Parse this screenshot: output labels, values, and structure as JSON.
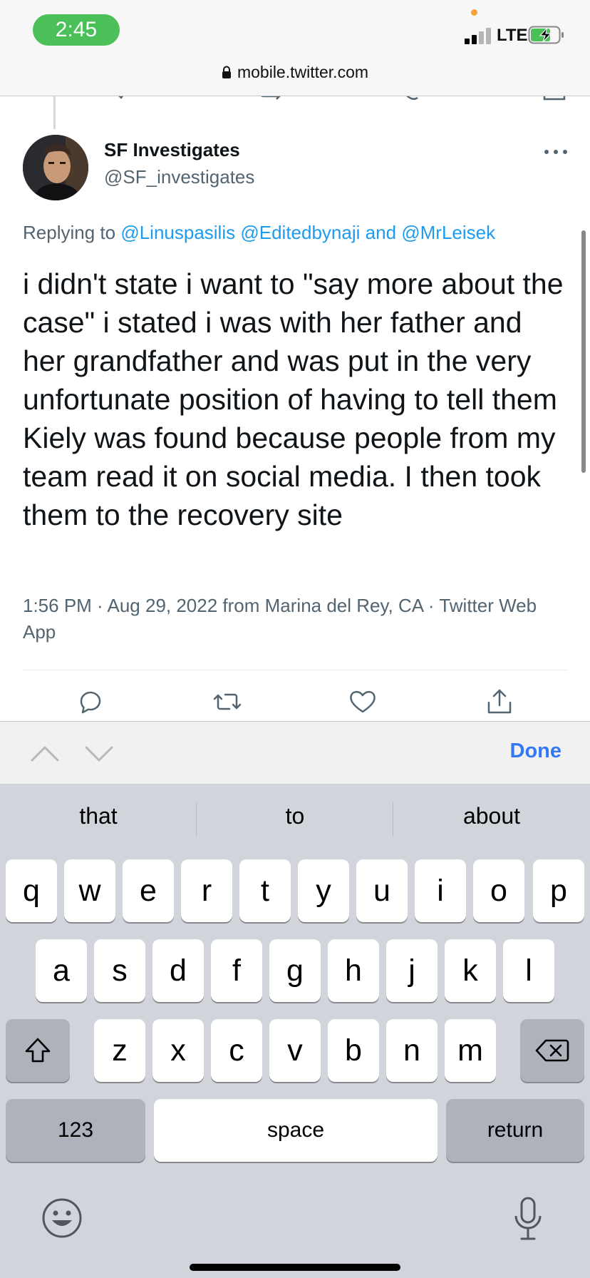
{
  "status_bar": {
    "time": "2:45",
    "network": "LTE"
  },
  "browser": {
    "url": "mobile.twitter.com"
  },
  "tweet": {
    "display_name": "SF Investigates",
    "handle": "@SF_investigates",
    "replying_prefix": "Replying to ",
    "mentions": [
      "@Linuspasilis",
      "@Editedbynaji"
    ],
    "and_word": " and ",
    "last_mention": "@MrLeisek",
    "text": "i didn't state i want to \"say more about the case\" i stated i was with her father and her grandfather and was put in the very unfortunate position of having to tell them Kiely was found because people from my team read it on social media. I then took them to the recovery site",
    "meta_line": "1:56 PM · Aug 29, 2022 from Marina del Rey, CA · Twitter Web App",
    "actions": [
      "reply-icon",
      "retweet-icon",
      "like-icon",
      "share-icon"
    ]
  },
  "toolbar": {
    "done_label": "Done"
  },
  "keyboard": {
    "suggestions": [
      "that",
      "to",
      "about"
    ],
    "row1": [
      "q",
      "w",
      "e",
      "r",
      "t",
      "y",
      "u",
      "i",
      "o",
      "p"
    ],
    "row2": [
      "a",
      "s",
      "d",
      "f",
      "g",
      "h",
      "j",
      "k",
      "l"
    ],
    "row3": [
      "z",
      "x",
      "c",
      "v",
      "b",
      "n",
      "m"
    ],
    "numbers_label": "123",
    "space_label": "space",
    "return_label": "return"
  },
  "colors": {
    "link": "#1d9bf0",
    "done": "#3478f6",
    "time_pill": "#4cc058",
    "keyboard_bg": "#d1d4da"
  }
}
